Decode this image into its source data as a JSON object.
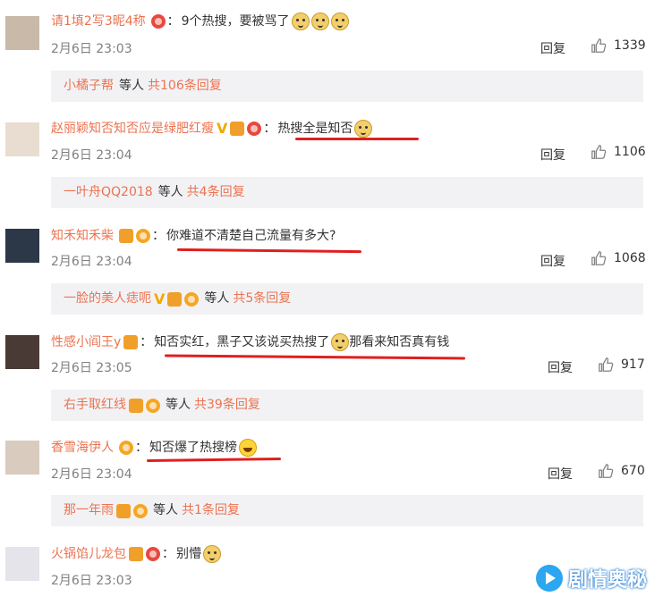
{
  "comments": [
    {
      "user": "请1填2写3昵4称",
      "text": "9个热搜，要被骂了",
      "time": "2月6日 23:03",
      "reply_label": "回复",
      "likes": "1339",
      "sub": {
        "users": "小橘子帮",
        "mid": "等人",
        "count": "共106条回复"
      }
    },
    {
      "user": "赵丽颖知否知否应是绿肥红瘦",
      "text": "热搜全是知否",
      "time": "2月6日 23:04",
      "reply_label": "回复",
      "likes": "1106",
      "sub": {
        "users": "一叶舟QQ2018",
        "mid": "等人",
        "count": "共4条回复"
      }
    },
    {
      "user": "知禾知禾柴",
      "text": "你难道不清楚自己流量有多大?",
      "time": "2月6日 23:04",
      "reply_label": "回复",
      "likes": "1068",
      "sub": {
        "users": "一脸的美人痣呃",
        "mid": "等人",
        "count": "共5条回复"
      }
    },
    {
      "user": "性感小阎王y",
      "text": "知否实红，黑子又该说买热搜了",
      "text2": "那看来知否真有钱",
      "time": "2月6日 23:05",
      "reply_label": "回复",
      "likes": "917",
      "sub": {
        "users": "右手取红线",
        "mid": "等人",
        "count": "共39条回复"
      }
    },
    {
      "user": "香雪海伊人",
      "text": "知否爆了热搜榜",
      "time": "2月6日 23:04",
      "reply_label": "回复",
      "likes": "670",
      "sub": {
        "users": "那一年雨",
        "mid": "等人",
        "count": "共1条回复"
      }
    },
    {
      "user": "火锅馅儿龙包",
      "text": "别懵",
      "time": "2月6日 23:03"
    }
  ],
  "colon": "：",
  "watermark": "剧情奥秘",
  "colors": {
    "username": "#eb7350",
    "underline": "#e01f1f",
    "subbox": "#f2f2f5"
  }
}
